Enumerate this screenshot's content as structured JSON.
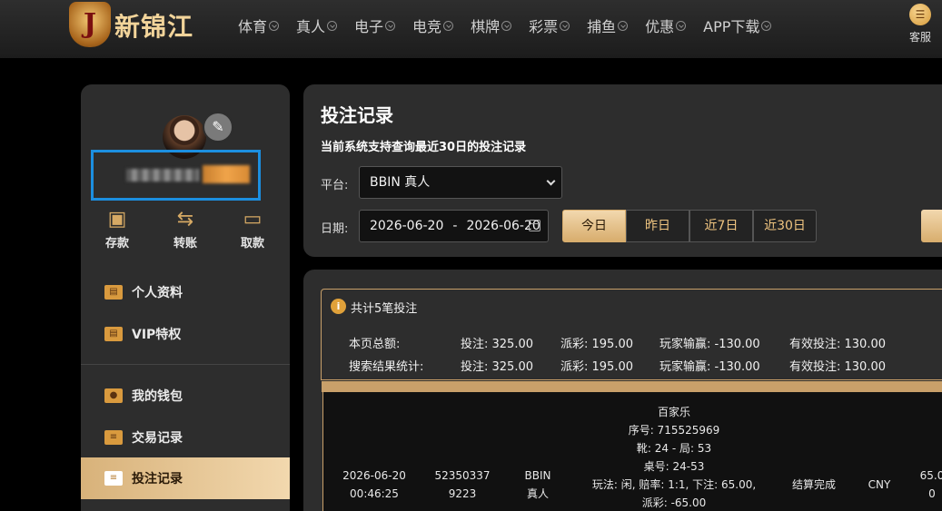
{
  "brand": {
    "logo_letter": "J",
    "name": "新锦江"
  },
  "nav": {
    "items": [
      "体育",
      "真人",
      "电子",
      "电竞",
      "棋牌",
      "彩票",
      "捕鱼",
      "优惠",
      "APP下载"
    ],
    "service_label": "客服"
  },
  "sidebar": {
    "quick_actions": [
      "存款",
      "转账",
      "取款"
    ],
    "items": [
      "个人资料",
      "VIP特权",
      "我的钱包",
      "交易记录",
      "投注记录"
    ],
    "active_item": "投注记录"
  },
  "bet_query": {
    "title": "投注记录",
    "note": "当前系统支持查询最近30日的投注记录",
    "platform_label": "平台:",
    "platform_value": "BBIN 真人",
    "date_label": "日期:",
    "date_start": "2026-06-20",
    "date_separator": "-",
    "date_end": "2026-06-20",
    "quick_ranges": [
      "今日",
      "昨日",
      "近7日",
      "近30日"
    ],
    "active_range": "今日"
  },
  "summary": {
    "count_text": "共计5笔投注",
    "rows": [
      {
        "label": "本页总额:",
        "bet": "投注: 325.00",
        "payout": "派彩: 195.00",
        "winloss": "玩家输赢: -130.00",
        "valid": "有效投注: 130.00"
      },
      {
        "label": "搜索结果统计:",
        "bet": "投注: 325.00",
        "payout": "派彩: 195.00",
        "winloss": "玩家输赢: -130.00",
        "valid": "有效投注: 130.00"
      }
    ]
  },
  "records": [
    {
      "date": "2026-06-20",
      "time": "00:46:25",
      "order_no_line1": "52350337",
      "order_no_line2": "9223",
      "platform_line1": "BBIN",
      "platform_line2": "真人",
      "detail_lines": [
        "百家乐",
        "序号: 715525969",
        "靴: 24 - 局: 53",
        "桌号: 24-53",
        "玩法: 闲, 赔率: 1:1, 下注: 65.00,",
        "派彩: -65.00"
      ],
      "status": "结算完成",
      "currency": "CNY",
      "amount_line1": "65.0",
      "amount_line2": "0"
    }
  ],
  "colors": {
    "accent_gold": "#d8ad6d",
    "highlight_blue": "#1c8fe0",
    "panel_bg": "#2d2d2d"
  }
}
